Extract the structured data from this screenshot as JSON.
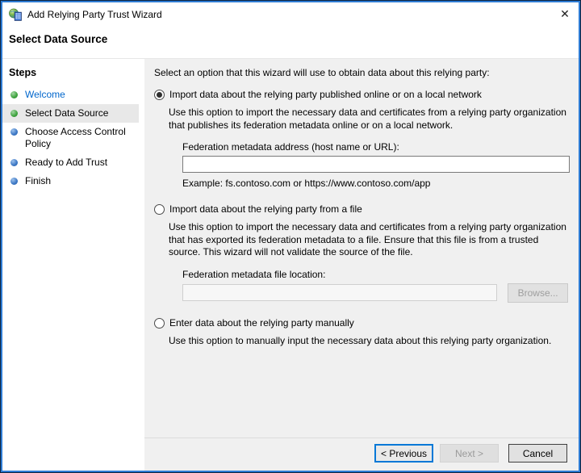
{
  "window": {
    "title": "Add Relying Party Trust Wizard",
    "close_glyph": "✕"
  },
  "page": {
    "heading": "Select Data Source"
  },
  "sidebar": {
    "title": "Steps",
    "items": [
      {
        "label": "Welcome",
        "bullet": "green",
        "current": false
      },
      {
        "label": "Select Data Source",
        "bullet": "green",
        "current": true
      },
      {
        "label": "Choose Access Control Policy",
        "bullet": "blue",
        "current": false
      },
      {
        "label": "Ready to Add Trust",
        "bullet": "blue",
        "current": false
      },
      {
        "label": "Finish",
        "bullet": "blue",
        "current": false
      }
    ]
  },
  "main": {
    "intro": "Select an option that this wizard will use to obtain data about this relying party:",
    "option_online": {
      "label": "Import data about the relying party published online or on a local network",
      "selected": true,
      "description": "Use this option to import the necessary data and certificates from a relying party organization that publishes its federation metadata online or on a local network.",
      "field_label": "Federation metadata address (host name or URL):",
      "field_value": "",
      "example": "Example: fs.contoso.com or https://www.contoso.com/app"
    },
    "option_file": {
      "label": "Import data about the relying party from a file",
      "selected": false,
      "description": "Use this option to import the necessary data and certificates from a relying party organization that has exported its federation metadata to a file. Ensure that this file is from a trusted source.  This wizard will not validate the source of the file.",
      "field_label": "Federation metadata file location:",
      "field_value": "",
      "browse_label": "Browse..."
    },
    "option_manual": {
      "label": "Enter data about the relying party manually",
      "selected": false,
      "description": "Use this option to manually input the necessary data about this relying party organization."
    }
  },
  "footer": {
    "previous_label": "< Previous",
    "next_label": "Next >",
    "cancel_label": "Cancel",
    "next_enabled": false
  },
  "colors": {
    "window_border": "#2d7bd4",
    "focus_blue": "#0078d7",
    "link_blue": "#0066cc",
    "bullet_green": "#3ea33e",
    "bullet_blue": "#3a76c4",
    "content_bg": "#f0f0f0"
  }
}
